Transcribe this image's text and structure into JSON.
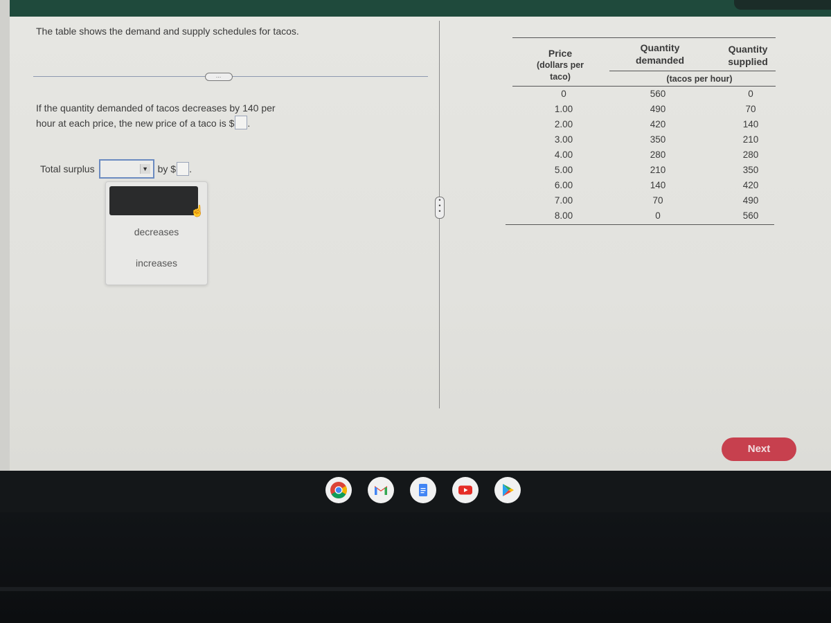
{
  "question": {
    "intro": "The table shows the demand and supply schedules for tacos.",
    "prompt": "If the quantity demanded of tacos decreases by 140 per hour at each price, the new price of a taco is $",
    "price_answer": "",
    "total_surplus_label": "Total surplus",
    "total_surplus_selected": "",
    "by_label": "by $",
    "surplus_amount_answer": "",
    "separator_handle": "…"
  },
  "dropdown": {
    "options": [
      "",
      "decreases",
      "increases"
    ]
  },
  "table": {
    "headers": {
      "price": [
        "Price",
        "(dollars per",
        "taco)"
      ],
      "quantity_demanded": [
        "Quantity",
        "demanded"
      ],
      "quantity_supplied": [
        "Quantity",
        "supplied"
      ],
      "units": "(tacos per hour)"
    },
    "rows": [
      {
        "price": "0",
        "qd": "560",
        "qs": "0"
      },
      {
        "price": "1.00",
        "qd": "490",
        "qs": "70"
      },
      {
        "price": "2.00",
        "qd": "420",
        "qs": "140"
      },
      {
        "price": "3.00",
        "qd": "350",
        "qs": "210"
      },
      {
        "price": "4.00",
        "qd": "280",
        "qs": "280"
      },
      {
        "price": "5.00",
        "qd": "210",
        "qs": "350"
      },
      {
        "price": "6.00",
        "qd": "140",
        "qs": "420"
      },
      {
        "price": "7.00",
        "qd": "70",
        "qs": "490"
      },
      {
        "price": "8.00",
        "qd": "0",
        "qs": "560"
      }
    ]
  },
  "buttons": {
    "next": "Next"
  },
  "shelf": {
    "apps": [
      "chrome-icon",
      "gmail-icon",
      "docs-icon",
      "youtube-icon",
      "play-store-icon"
    ]
  },
  "colors": {
    "next_bg": "#c7404e",
    "select_border": "#6a8ac0",
    "topbar": "#1f4a3c"
  }
}
